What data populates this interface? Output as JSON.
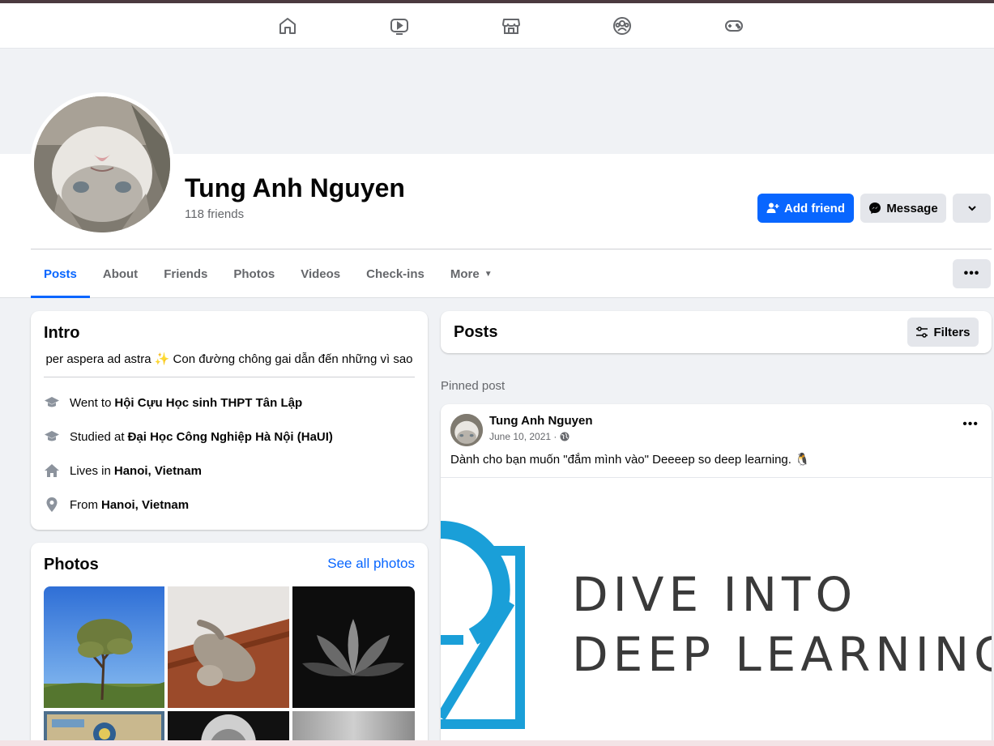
{
  "nav": {
    "icons": [
      "home-icon",
      "video-icon",
      "marketplace-icon",
      "groups-icon",
      "gaming-icon"
    ]
  },
  "profile": {
    "name": "Tung Anh Nguyen",
    "friends": "118 friends",
    "add_friend_label": "Add friend",
    "message_label": "Message"
  },
  "tabs": [
    {
      "label": "Posts",
      "active": true
    },
    {
      "label": "About"
    },
    {
      "label": "Friends"
    },
    {
      "label": "Photos"
    },
    {
      "label": "Videos"
    },
    {
      "label": "Check-ins"
    },
    {
      "label": "More"
    }
  ],
  "intro": {
    "title": "Intro",
    "bio": "per aspera ad astra ✨ Con đường chông gai dẫn đến những vì sao",
    "items": [
      {
        "icon": "graduation-cap-icon",
        "prefix": "Went to",
        "value": "Hội Cựu Học sinh THPT Tân Lập"
      },
      {
        "icon": "graduation-cap-icon",
        "prefix": "Studied at",
        "value": "Đại Học Công Nghiệp Hà Nội (HaUI)"
      },
      {
        "icon": "house-icon",
        "prefix": "Lives in",
        "value": "Hanoi, Vietnam"
      },
      {
        "icon": "location-pin-icon",
        "prefix": "From",
        "value": "Hanoi, Vietnam"
      }
    ]
  },
  "photos": {
    "title": "Photos",
    "see_all": "See all photos"
  },
  "posts": {
    "title": "Posts",
    "filters_label": "Filters",
    "pinned_label": "Pinned post",
    "post": {
      "author": "Tung Anh Nguyen",
      "date": "June 10, 2021 ·",
      "text": "Dành cho bạn muốn \"đắm mình vào\" Deeeep so deep learning. 🐧",
      "image_line1": "DIVE INTO",
      "image_line2": "DEEP LEARNING"
    }
  },
  "colors": {
    "primary": "#0866ff",
    "secondary_button": "#e4e6eb",
    "background": "#f0f2f5",
    "d2l_blue": "#1a9fd8"
  }
}
